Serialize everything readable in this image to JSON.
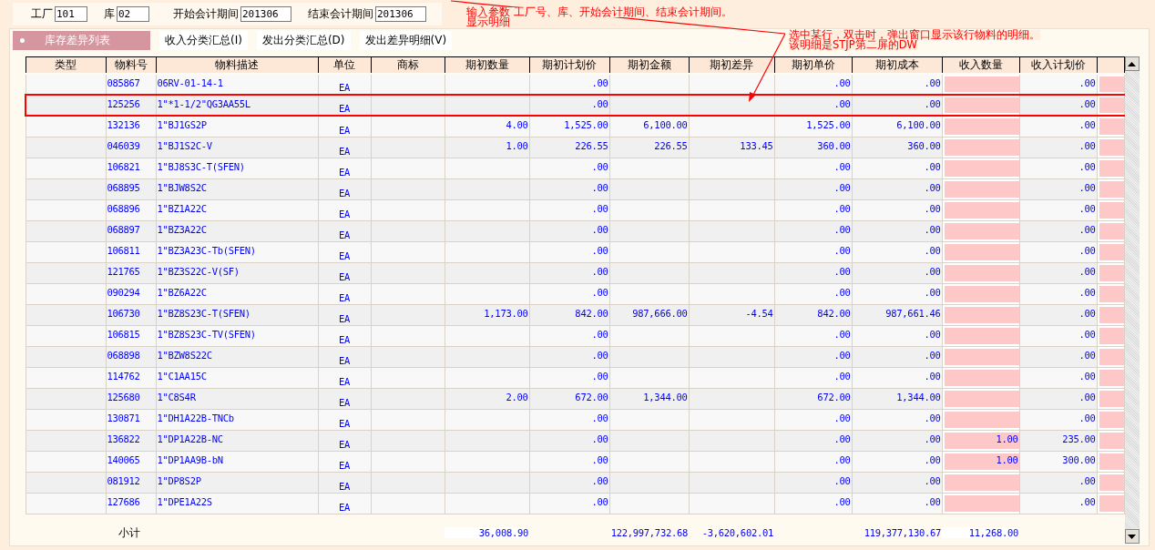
{
  "params": [
    {
      "label": "工厂",
      "value": "101"
    },
    {
      "label": "库",
      "value": "02"
    },
    {
      "label": "开始会计期间",
      "value": "201306"
    },
    {
      "label": "结束会计期间",
      "value": "201306"
    }
  ],
  "annotations": [
    {
      "lines": [
        "输入参数  工厂号、库、开始会计期间、结束会计期间。",
        "显示明细"
      ]
    },
    {
      "lines": [
        "选中某行，双击时，弹出窗口显示该行物料的明细。",
        "该明细是STJP第二屏的DW"
      ]
    }
  ],
  "tabs": [
    {
      "label": "库存差异列表",
      "selected": true
    },
    {
      "label": "收入分类汇总(I)",
      "selected": false
    },
    {
      "label": "发出分类汇总(D)",
      "selected": false
    },
    {
      "label": "发出差异明细(V)",
      "selected": false
    }
  ],
  "table": {
    "columns": [
      {
        "label": "类型",
        "highlighted": false
      },
      {
        "label": "物料号",
        "highlighted": false
      },
      {
        "label": "物料描述",
        "highlighted": false
      },
      {
        "label": "单位",
        "highlighted": false
      },
      {
        "label": "商标",
        "highlighted": false
      },
      {
        "label": "期初数量",
        "highlighted": false
      },
      {
        "label": "期初计划价",
        "highlighted": false
      },
      {
        "label": "期初金额",
        "highlighted": false
      },
      {
        "label": "期初差异",
        "highlighted": false
      },
      {
        "label": "期初单价",
        "highlighted": false
      },
      {
        "label": "期初成本",
        "highlighted": false
      },
      {
        "label": "收入数量",
        "highlighted": true
      },
      {
        "label": "收入计划价",
        "highlighted": false
      },
      {
        "highlighted": true
      }
    ],
    "rows": [
      {
        "selected": false,
        "cells": [
          null,
          "085867",
          "06RV-01-14-1",
          "EA",
          null,
          null,
          ".00",
          null,
          null,
          ".00",
          ".00",
          null,
          ".00",
          null
        ]
      },
      {
        "selected": true,
        "cells": [
          null,
          "125256",
          "1\"*1-1/2\"QG3AA55L",
          "EA",
          null,
          null,
          ".00",
          null,
          null,
          ".00",
          ".00",
          null,
          ".00",
          null
        ]
      },
      {
        "selected": false,
        "cells": [
          null,
          "132136",
          "1\"BJ1GS2P",
          "EA",
          null,
          "4.00",
          "1,525.00",
          "6,100.00",
          null,
          "1,525.00",
          "6,100.00",
          null,
          ".00",
          null
        ]
      },
      {
        "selected": false,
        "cells": [
          null,
          "046039",
          "1\"BJ1S2C-V",
          "EA",
          null,
          "1.00",
          "226.55",
          "226.55",
          "133.45",
          "360.00",
          "360.00",
          null,
          ".00",
          null
        ]
      },
      {
        "selected": false,
        "cells": [
          null,
          "106821",
          "1\"BJ8S3C-T(SFEN)",
          "EA",
          null,
          null,
          ".00",
          null,
          null,
          ".00",
          ".00",
          null,
          ".00",
          null
        ]
      },
      {
        "selected": false,
        "cells": [
          null,
          "068895",
          "1\"BJW8S2C",
          "EA",
          null,
          null,
          ".00",
          null,
          null,
          ".00",
          ".00",
          null,
          ".00",
          null
        ]
      },
      {
        "selected": false,
        "cells": [
          null,
          "068896",
          "1\"BZ1A22C",
          "EA",
          null,
          null,
          ".00",
          null,
          null,
          ".00",
          ".00",
          null,
          ".00",
          null
        ]
      },
      {
        "selected": false,
        "cells": [
          null,
          "068897",
          "1\"BZ3A22C",
          "EA",
          null,
          null,
          ".00",
          null,
          null,
          ".00",
          ".00",
          null,
          ".00",
          null
        ]
      },
      {
        "selected": false,
        "cells": [
          null,
          "106811",
          "1\"BZ3A23C-Tb(SFEN)",
          "EA",
          null,
          null,
          ".00",
          null,
          null,
          ".00",
          ".00",
          null,
          ".00",
          null
        ]
      },
      {
        "selected": false,
        "cells": [
          null,
          "121765",
          "1\"BZ3S22C-V(SF)",
          "EA",
          null,
          null,
          ".00",
          null,
          null,
          ".00",
          ".00",
          null,
          ".00",
          null
        ]
      },
      {
        "selected": false,
        "cells": [
          null,
          "090294",
          "1\"BZ6A22C",
          "EA",
          null,
          null,
          ".00",
          null,
          null,
          ".00",
          ".00",
          null,
          ".00",
          null
        ]
      },
      {
        "selected": false,
        "cells": [
          null,
          "106730",
          "1\"BZ8S23C-T(SFEN)",
          "EA",
          null,
          "1,173.00",
          "842.00",
          "987,666.00",
          "-4.54",
          "842.00",
          "987,661.46",
          null,
          ".00",
          null
        ]
      },
      {
        "selected": false,
        "cells": [
          null,
          "106815",
          "1\"BZ8S23C-TV(SFEN)",
          "EA",
          null,
          null,
          ".00",
          null,
          null,
          ".00",
          ".00",
          null,
          ".00",
          null
        ]
      },
      {
        "selected": false,
        "cells": [
          null,
          "068898",
          "1\"BZW8S22C",
          "EA",
          null,
          null,
          ".00",
          null,
          null,
          ".00",
          ".00",
          null,
          ".00",
          null
        ]
      },
      {
        "selected": false,
        "cells": [
          null,
          "114762",
          "1\"C1AA15C",
          "EA",
          null,
          null,
          ".00",
          null,
          null,
          ".00",
          ".00",
          null,
          ".00",
          null
        ]
      },
      {
        "selected": false,
        "cells": [
          null,
          "125680",
          "1\"C8S4R",
          "EA",
          null,
          "2.00",
          "672.00",
          "1,344.00",
          null,
          "672.00",
          "1,344.00",
          null,
          ".00",
          null
        ]
      },
      {
        "selected": false,
        "cells": [
          null,
          "130871",
          "1\"DH1A22B-TNCb",
          "EA",
          null,
          null,
          ".00",
          null,
          null,
          ".00",
          ".00",
          null,
          ".00",
          null
        ]
      },
      {
        "selected": false,
        "cells": [
          null,
          "136822",
          "1\"DP1A22B-NC",
          "EA",
          null,
          null,
          ".00",
          null,
          null,
          ".00",
          ".00",
          "1.00",
          "235.00",
          null
        ]
      },
      {
        "selected": false,
        "cells": [
          null,
          "140065",
          "1\"DP1AA9B-bN",
          "EA",
          null,
          null,
          ".00",
          null,
          null,
          ".00",
          ".00",
          "1.00",
          "300.00",
          null
        ]
      },
      {
        "selected": false,
        "cells": [
          null,
          "081912",
          "1\"DP8S2P",
          "EA",
          null,
          null,
          ".00",
          null,
          null,
          ".00",
          ".00",
          null,
          ".00",
          null
        ]
      },
      {
        "selected": false,
        "cells": [
          null,
          "127686",
          "1\"DPE1A22S",
          "EA",
          null,
          null,
          ".00",
          null,
          null,
          ".00",
          ".00",
          null,
          ".00",
          null
        ]
      }
    ],
    "totals": {
      "label": "小计",
      "cells": [
        null,
        null,
        null,
        null,
        null,
        {
          "text": "36,008.90",
          "boxed": true
        },
        null,
        {
          "text": "122,997,732.68",
          "boxed": false
        },
        {
          "text": "-3,620,602.01",
          "boxed": false
        },
        null,
        {
          "text": "119,377,130.67",
          "boxed": false
        },
        {
          "text": "11,268.00",
          "boxed": true
        },
        null,
        null
      ]
    }
  }
}
